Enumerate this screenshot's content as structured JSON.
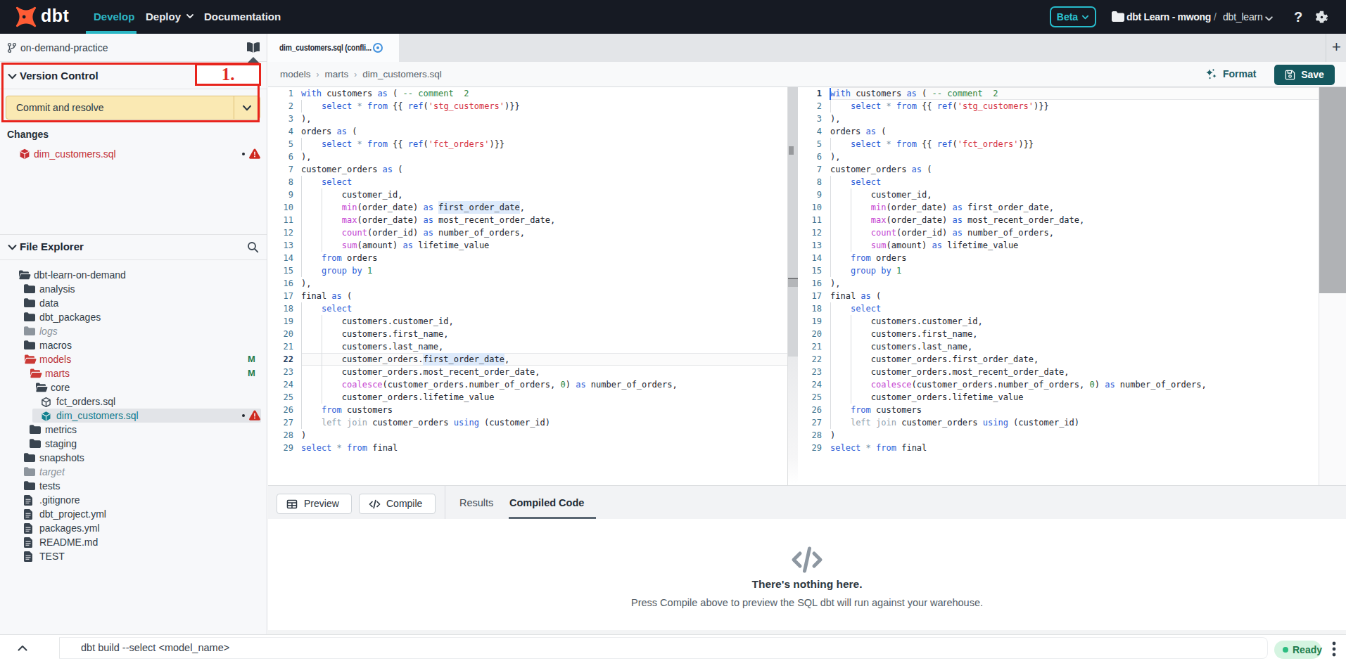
{
  "topnav": {
    "logo_text": "dbt",
    "menu": [
      {
        "label": "Develop",
        "active": true
      },
      {
        "label": "Deploy",
        "chevron": true
      },
      {
        "label": "Documentation"
      }
    ],
    "beta_label": "Beta",
    "account": "dbt Learn - mwong",
    "path_separator": "/",
    "project": "dbt_learn",
    "help_label": "?"
  },
  "sidebar": {
    "branch_name": "on-demand-practice",
    "version_control": {
      "title": "Version Control",
      "commit_button_label": "Commit and resolve",
      "changes_title": "Changes",
      "changes": [
        {
          "name": "dim_customers.sql",
          "icon": "model-cube-icon",
          "has_dot": true,
          "has_warning": true
        }
      ]
    },
    "annotation_label": "1.",
    "file_explorer": {
      "title": "File Explorer",
      "tree": [
        {
          "label": "dbt-learn-on-demand",
          "icon": "folder-open",
          "level": 0,
          "state": "normal"
        },
        {
          "label": "analysis",
          "icon": "folder",
          "level": 1,
          "state": "normal"
        },
        {
          "label": "data",
          "icon": "folder",
          "level": 1,
          "state": "normal"
        },
        {
          "label": "dbt_packages",
          "icon": "folder",
          "level": 1,
          "state": "normal"
        },
        {
          "label": "logs",
          "icon": "folder",
          "level": 1,
          "state": "muted"
        },
        {
          "label": "macros",
          "icon": "folder",
          "level": 1,
          "state": "normal"
        },
        {
          "label": "models",
          "icon": "folder-open",
          "level": 1,
          "state": "red",
          "badge": "M"
        },
        {
          "label": "marts",
          "icon": "folder-open",
          "level": 2,
          "state": "red",
          "badge": "M"
        },
        {
          "label": "core",
          "icon": "folder-open",
          "level": 3,
          "state": "normal"
        },
        {
          "label": "fct_orders.sql",
          "icon": "cube",
          "level": 4,
          "state": "normal"
        },
        {
          "label": "dim_customers.sql",
          "icon": "cube",
          "level": 4,
          "state": "selected",
          "has_dot": true,
          "has_warning": true
        },
        {
          "label": "metrics",
          "icon": "folder",
          "level": 2,
          "state": "normal"
        },
        {
          "label": "staging",
          "icon": "folder",
          "level": 2,
          "state": "normal"
        },
        {
          "label": "snapshots",
          "icon": "folder",
          "level": 1,
          "state": "normal"
        },
        {
          "label": "target",
          "icon": "folder",
          "level": 1,
          "state": "muted"
        },
        {
          "label": "tests",
          "icon": "folder",
          "level": 1,
          "state": "normal"
        },
        {
          "label": ".gitignore",
          "icon": "file",
          "level": 1,
          "state": "normal"
        },
        {
          "label": "dbt_project.yml",
          "icon": "file",
          "level": 1,
          "state": "normal"
        },
        {
          "label": "packages.yml",
          "icon": "file",
          "level": 1,
          "state": "normal"
        },
        {
          "label": "README.md",
          "icon": "file",
          "level": 1,
          "state": "normal"
        },
        {
          "label": "TEST",
          "icon": "file",
          "level": 1,
          "state": "normal"
        }
      ]
    }
  },
  "editor": {
    "tab_title": "dim_customers.sql (confli...",
    "breadcrumb": [
      "models",
      "marts",
      "dim_customers.sql"
    ],
    "format_label": "Format",
    "save_label": "Save",
    "code": {
      "left_active_line": 22,
      "right_active_line": 1,
      "highlights": [
        {
          "line": 10,
          "ch": 27,
          "len": 16
        },
        {
          "line": 22,
          "ch": 24,
          "len": 16
        }
      ],
      "cursor": {
        "pane": "right",
        "line": 1,
        "ch": 0
      },
      "lines": [
        [
          [
            "k",
            "with"
          ],
          [
            "t",
            " customers "
          ],
          [
            "k",
            "as"
          ],
          [
            "t",
            " ( "
          ],
          [
            "c",
            "-- comment  2"
          ]
        ],
        [
          [
            "t",
            "    "
          ],
          [
            "k",
            "select"
          ],
          [
            "t",
            " "
          ],
          [
            "o",
            "*"
          ],
          [
            "t",
            " "
          ],
          [
            "k",
            "from"
          ],
          [
            "t",
            " {{ "
          ],
          [
            "k",
            "ref"
          ],
          [
            "t",
            "("
          ],
          [
            "s",
            "'stg_customers'"
          ],
          [
            "t",
            ")}}"
          ]
        ],
        [
          [
            "t",
            "),"
          ]
        ],
        [
          [
            "t",
            "orders "
          ],
          [
            "k",
            "as"
          ],
          [
            "t",
            " ("
          ]
        ],
        [
          [
            "t",
            "    "
          ],
          [
            "k",
            "select"
          ],
          [
            "t",
            " "
          ],
          [
            "o",
            "*"
          ],
          [
            "t",
            " "
          ],
          [
            "k",
            "from"
          ],
          [
            "t",
            " {{ "
          ],
          [
            "k",
            "ref"
          ],
          [
            "t",
            "("
          ],
          [
            "s",
            "'fct_orders'"
          ],
          [
            "t",
            ")}}"
          ]
        ],
        [
          [
            "t",
            "),"
          ]
        ],
        [
          [
            "t",
            "customer_orders "
          ],
          [
            "k",
            "as"
          ],
          [
            "t",
            " ("
          ]
        ],
        [
          [
            "t",
            "    "
          ],
          [
            "k",
            "select"
          ]
        ],
        [
          [
            "t",
            "        customer_id,"
          ]
        ],
        [
          [
            "t",
            "        "
          ],
          [
            "f",
            "min"
          ],
          [
            "t",
            "(order_date) "
          ],
          [
            "k",
            "as"
          ],
          [
            "t",
            " first_order_date,"
          ]
        ],
        [
          [
            "t",
            "        "
          ],
          [
            "f",
            "max"
          ],
          [
            "t",
            "(order_date) "
          ],
          [
            "k",
            "as"
          ],
          [
            "t",
            " most_recent_order_date,"
          ]
        ],
        [
          [
            "t",
            "        "
          ],
          [
            "f",
            "count"
          ],
          [
            "t",
            "(order_id) "
          ],
          [
            "k",
            "as"
          ],
          [
            "t",
            " number_of_orders,"
          ]
        ],
        [
          [
            "t",
            "        "
          ],
          [
            "f",
            "sum"
          ],
          [
            "t",
            "(amount) "
          ],
          [
            "k",
            "as"
          ],
          [
            "t",
            " lifetime_value"
          ]
        ],
        [
          [
            "t",
            "    "
          ],
          [
            "k",
            "from"
          ],
          [
            "t",
            " orders"
          ]
        ],
        [
          [
            "t",
            "    "
          ],
          [
            "k",
            "group"
          ],
          [
            "t",
            " "
          ],
          [
            "k",
            "by"
          ],
          [
            "t",
            " "
          ],
          [
            "n",
            "1"
          ]
        ],
        [
          [
            "t",
            "),"
          ]
        ],
        [
          [
            "t",
            "final "
          ],
          [
            "k",
            "as"
          ],
          [
            "t",
            " ("
          ]
        ],
        [
          [
            "t",
            "    "
          ],
          [
            "k",
            "select"
          ]
        ],
        [
          [
            "t",
            "        customers.customer_id,"
          ]
        ],
        [
          [
            "t",
            "        customers.first_name,"
          ]
        ],
        [
          [
            "t",
            "        customers.last_name,"
          ]
        ],
        [
          [
            "t",
            "        customer_orders.first_order_date,"
          ]
        ],
        [
          [
            "t",
            "        customer_orders.most_recent_order_date,"
          ]
        ],
        [
          [
            "t",
            "        "
          ],
          [
            "f",
            "coalesce"
          ],
          [
            "t",
            "(customer_orders.number_of_orders, "
          ],
          [
            "n",
            "0"
          ],
          [
            "t",
            ") "
          ],
          [
            "k",
            "as"
          ],
          [
            "t",
            " number_of_orders,"
          ]
        ],
        [
          [
            "t",
            "        customer_orders.lifetime_value"
          ]
        ],
        [
          [
            "t",
            "    "
          ],
          [
            "k",
            "from"
          ],
          [
            "t",
            " customers"
          ]
        ],
        [
          [
            "t",
            "    "
          ],
          [
            "g",
            "left join"
          ],
          [
            "t",
            " customer_orders "
          ],
          [
            "k",
            "using"
          ],
          [
            "t",
            " (customer_id)"
          ]
        ],
        [
          [
            "t",
            ")"
          ]
        ],
        [
          [
            "k",
            "select"
          ],
          [
            "t",
            " "
          ],
          [
            "o",
            "*"
          ],
          [
            "t",
            " "
          ],
          [
            "k",
            "from"
          ],
          [
            "t",
            " final"
          ]
        ]
      ]
    }
  },
  "bottom_panel": {
    "preview_label": "Preview",
    "compile_label": "Compile",
    "tabs": [
      {
        "label": "Results",
        "active": false
      },
      {
        "label": "Compiled Code",
        "active": true
      }
    ],
    "empty_state": {
      "title": "There's nothing here.",
      "subtitle": "Press Compile above to preview the SQL dbt will run against your warehouse."
    }
  },
  "status_bar": {
    "command": "dbt build --select <model_name>",
    "ready_label": "Ready"
  },
  "colors": {
    "accent_teal": "#2bb7c5",
    "brand_orange": "#ff5c35",
    "save_button": "#14575e",
    "annotation_red": "#e8241c",
    "commit_button_bg": "#fae9b3",
    "changed_file_red": "#c22f36",
    "modified_badge_green": "#1e7b4b",
    "ready_green": "#1d7c4c"
  }
}
